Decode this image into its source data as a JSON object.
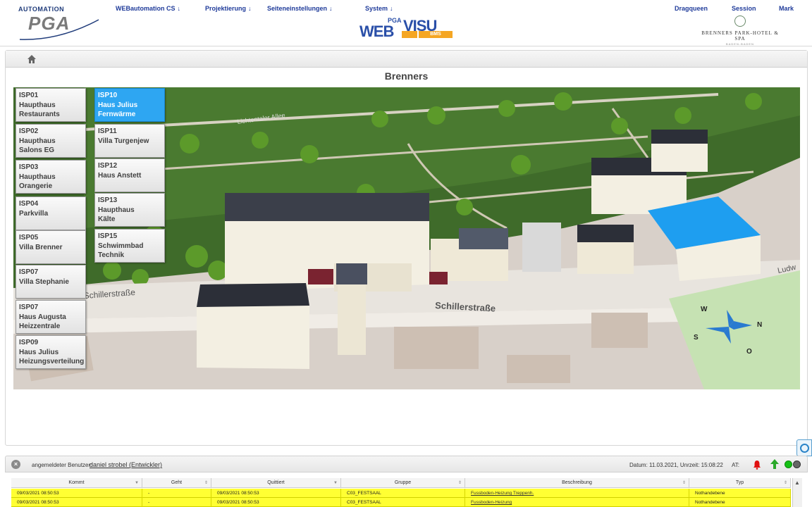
{
  "header": {
    "brand_top": "AUTOMATION",
    "brand_main": "PGA",
    "nav": [
      {
        "label": "WEBautomation CS",
        "arrow": "↓"
      },
      {
        "label": "Projektierung",
        "arrow": "↓"
      },
      {
        "label": "Seiteneinstellungen",
        "arrow": "↓"
      },
      {
        "label": "System",
        "arrow": "↓"
      }
    ],
    "right_links": [
      "Dragqueen",
      "Session",
      "Mark"
    ],
    "center_logo": {
      "pga": "PGA",
      "web": "WEB",
      "visu": "VISU",
      "bms": "BMS"
    },
    "hotel_logo": {
      "name": "BRENNERS PARK-HOTEL & SPA",
      "sub": "BADEN-BADEN"
    }
  },
  "page": {
    "title": "Brenners"
  },
  "map": {
    "street_label": "Schillerstraße",
    "street_label_left": "Schillerstraße",
    "street_label_top": "Lichtentaler Allee",
    "street_label_right": "Ludw",
    "compass": {
      "n": "N",
      "s": "S",
      "w": "W",
      "o": "O"
    }
  },
  "isp_buttons": [
    {
      "code": "ISP01",
      "line1": "Haupthaus",
      "line2": "Restaurants",
      "active": false
    },
    {
      "code": "ISP02",
      "line1": "Haupthaus",
      "line2": "Salons EG",
      "active": false
    },
    {
      "code": "ISP03",
      "line1": "Haupthaus",
      "line2": "Orangerie",
      "active": false
    },
    {
      "code": "ISP04",
      "line1": "Parkvilla",
      "line2": "",
      "active": false
    },
    {
      "code": "ISP05",
      "line1": "Villa Brenner",
      "line2": "",
      "active": false
    },
    {
      "code": "ISP07",
      "line1": "Villa Stephanie",
      "line2": "",
      "active": false
    },
    {
      "code": "ISP07",
      "line1": "Haus Augusta",
      "line2": "Heizzentrale",
      "active": false
    },
    {
      "code": "ISP09",
      "line1": "Haus Julius",
      "line2": "Heizungsverteilung",
      "active": false
    },
    {
      "code": "ISP10",
      "line1": "Haus Julius",
      "line2": "Fernwärme",
      "active": true
    },
    {
      "code": "ISP11",
      "line1": "Villa Turgenjew",
      "line2": "",
      "active": false
    },
    {
      "code": "ISP12",
      "line1": "Haus Anstett",
      "line2": "",
      "active": false
    },
    {
      "code": "ISP13",
      "line1": "Haupthaus",
      "line2": "Kälte",
      "active": false
    },
    {
      "code": "ISP15",
      "line1": "Schwimmbad",
      "line2": "Technik",
      "active": false
    }
  ],
  "status": {
    "user_label": "angemeldeter Benutzer:",
    "user_name": "daniel strobel (Entwickler)",
    "datetime": "Datum: 11.03.2021, Unrzeit: 15:08:22",
    "at": "AT:"
  },
  "alarms": {
    "columns": [
      "Kommt",
      "Geht",
      "Quittiert",
      "Gruppe",
      "Beschreibung",
      "Typ"
    ],
    "rows": [
      [
        "09/03/2021 08:50:53",
        "-",
        "09/03/2021 08:50:53",
        "C03_FESTSAAL",
        "Fussboden-Heizung Treppenh.",
        "Nothandebene"
      ],
      [
        "09/03/2021 08:50:53",
        "-",
        "09/03/2021 08:50:53",
        "C03_FESTSAAL",
        "Fussboden-Heizung",
        "Nothandebene"
      ]
    ]
  },
  "colors": {
    "active_button": "#2ea6f2",
    "nav_link": "#1f3b9a",
    "alarm_row": "#ffff33",
    "highlighted_building": "#1e9ef0"
  }
}
